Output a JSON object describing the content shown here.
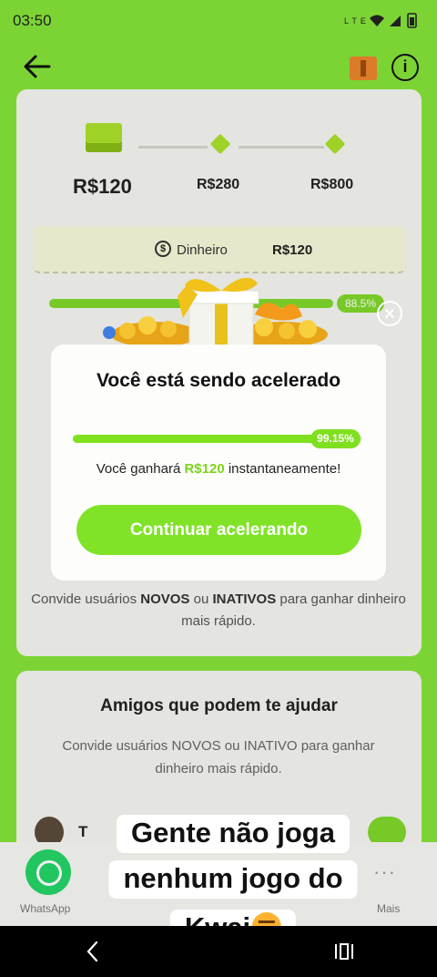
{
  "status_bar": {
    "time": "03:50",
    "icons": [
      "lte-icon",
      "wifi-icon",
      "signal-icon",
      "battery-icon"
    ]
  },
  "header": {
    "back": "back-arrow-icon",
    "ticket": "ticket-icon",
    "info": "i"
  },
  "milestones": [
    {
      "label": "R$120",
      "active": true
    },
    {
      "label": "R$280",
      "active": false
    },
    {
      "label": "R$800",
      "active": false
    }
  ],
  "balance": {
    "icon": "$",
    "label": "Dinheiro",
    "value": "R$120"
  },
  "background_progress": {
    "percent_label": "88.5%",
    "fraction": 0.885
  },
  "invite_hint": {
    "prefix": "Convide usuários ",
    "novos": "NOVOS",
    "ou": " ou ",
    "inativos": "INATIVOS",
    "suffix": " para ganhar dinheiro mais rápido."
  },
  "friends": {
    "title": "Amigos que podem te ajudar",
    "subtitle": "Convide usuários NOVOS ou INATIVO para ganhar dinheiro mais rápido.",
    "first_initial": "T"
  },
  "share": {
    "whatsapp_label": "WhatsApp",
    "more_label": "Mais",
    "more_glyph": "···"
  },
  "modal": {
    "title": "Você está sendo acelerado",
    "progress_fraction": 0.9915,
    "progress_label": "99.15%",
    "msg_prefix": "Você ganhará ",
    "msg_amount": "R$120",
    "msg_suffix": " instantaneamente!",
    "cta": "Continuar acelerando"
  },
  "caption": {
    "line1": "Gente não joga",
    "line2": "nenhum jogo do",
    "line3": "Kwai"
  },
  "colors": {
    "accent": "#80e327",
    "background": "#84e238",
    "card": "#f3f3ee",
    "ticket": "#e9842b"
  }
}
